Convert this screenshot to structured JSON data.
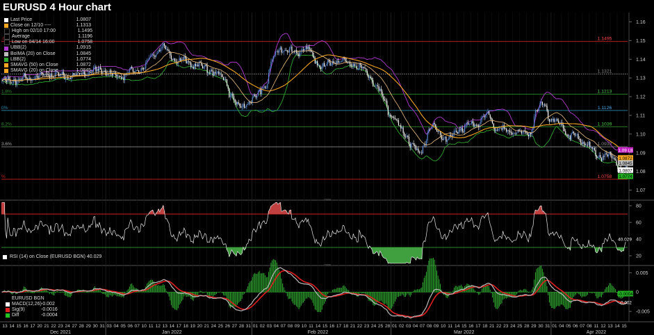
{
  "window": {
    "title": "EURUSD 4 Hour chart"
  },
  "legend": [
    {
      "label": "Last Price",
      "value": "1.0807",
      "color": "#ffffff"
    },
    {
      "label": "Close on 12/10 ----",
      "value": "1.1313",
      "color": "#f5a623"
    },
    {
      "label": "High on 02/10 17:00",
      "value": "1.1495",
      "color": "#000000"
    },
    {
      "label": "Average",
      "value": "1.1196",
      "color": "#000000"
    },
    {
      "label": "Low on 04/14 16:00",
      "value": "1.0758",
      "color": "#000000"
    },
    {
      "label": "UBB(2)",
      "value": "1.0915",
      "color": "#b03ad0"
    },
    {
      "label": "BoIMA (20)  on Close",
      "value": "1.0845",
      "color": "#bbbbbb"
    },
    {
      "label": "LBB(2)",
      "value": "1.0774",
      "color": "#2fa82f"
    },
    {
      "label": "SMAVG (50)  on Close",
      "value": "1.0872",
      "color": "#f5a623"
    },
    {
      "label": "SMAVG (20)  on Close",
      "value": "1.0845",
      "color": "#f5a623"
    }
  ],
  "rsi": {
    "label": "RSI (14)  on Close (EURUSD BGN) 40.029",
    "value_badge": "40.029"
  },
  "macd": {
    "title": "EURUSD BGN",
    "rows": [
      {
        "label": "MACD(12,26)",
        "value": "-0.002",
        "color": "#ffffff"
      },
      {
        "label": "Sig(9)",
        "value": "-0.0016",
        "color": "#e02020"
      },
      {
        "label": "Diff",
        "value": "-0.0004",
        "color": "#22c022"
      }
    ]
  },
  "colors": {
    "up": "#5b8bd8",
    "down": "#ffffff",
    "upper_band": "#b03ad0",
    "lower_band": "#2fa82f",
    "sma": "#f5a623",
    "fib_red": "#cc2222",
    "fib_green": "#2a8a2a",
    "fib_blue": "#2a8ab0",
    "grid": "#151515"
  },
  "chart_data": [
    {
      "type": "candlestick",
      "title": "EURUSD 4 Hour chart",
      "ylim": [
        1.065,
        1.165
      ],
      "y_ticks": [
        "1.16",
        "1.15",
        "1.14",
        "1.13",
        "1.12",
        "1.11",
        "1.10",
        "1.09",
        "1.08",
        "1.07"
      ],
      "x_days": [
        "13",
        "14",
        "15",
        "16",
        "17",
        "20",
        "21",
        "22",
        "23",
        "24",
        "27",
        "28",
        "29",
        "30",
        "31",
        "03",
        "04",
        "05",
        "06",
        "07",
        "10",
        "11",
        "12",
        "13",
        "14",
        "17",
        "18",
        "19",
        "20",
        "21",
        "24",
        "25",
        "26",
        "27",
        "28",
        "31",
        "01",
        "02",
        "03",
        "04",
        "07",
        "08",
        "09",
        "10",
        "11",
        "14",
        "15",
        "16",
        "17",
        "18",
        "21",
        "22",
        "23",
        "24",
        "25",
        "28",
        "01",
        "02",
        "03",
        "04",
        "07",
        "08",
        "09",
        "10",
        "11",
        "14",
        "15",
        "16",
        "17",
        "18",
        "21",
        "22",
        "23",
        "24",
        "25",
        "28",
        "29",
        "30",
        "31",
        "01",
        "04",
        "05",
        "06",
        "07",
        "08",
        "11",
        "12",
        "13",
        "14",
        "15"
      ],
      "months": [
        {
          "label": "Dec 2021",
          "day_index": 8
        },
        {
          "label": "Jan 2022",
          "day_index": 24
        },
        {
          "label": "Feb 2022",
          "day_index": 45
        },
        {
          "label": "Mar 2022",
          "day_index": 66
        },
        {
          "label": "Apr 2022",
          "day_index": 85
        }
      ],
      "close_anchors": [
        [
          0,
          1.128
        ],
        [
          4,
          1.13
        ],
        [
          7,
          1.132
        ],
        [
          10,
          1.131
        ],
        [
          14,
          1.134
        ],
        [
          17,
          1.131
        ],
        [
          20,
          1.135
        ],
        [
          22,
          1.143
        ],
        [
          23,
          1.147
        ],
        [
          25,
          1.14
        ],
        [
          28,
          1.137
        ],
        [
          30,
          1.134
        ],
        [
          32,
          1.13
        ],
        [
          33,
          1.121
        ],
        [
          34,
          1.114
        ],
        [
          36,
          1.118
        ],
        [
          38,
          1.126
        ],
        [
          39,
          1.14
        ],
        [
          40,
          1.146
        ],
        [
          42,
          1.144
        ],
        [
          44,
          1.145
        ],
        [
          46,
          1.136
        ],
        [
          48,
          1.139
        ],
        [
          50,
          1.138
        ],
        [
          52,
          1.135
        ],
        [
          53,
          1.13
        ],
        [
          54,
          1.125
        ],
        [
          55,
          1.118
        ],
        [
          56,
          1.11
        ],
        [
          58,
          1.101
        ],
        [
          59,
          1.094
        ],
        [
          60,
          1.09
        ],
        [
          62,
          1.104
        ],
        [
          64,
          1.097
        ],
        [
          66,
          1.103
        ],
        [
          68,
          1.105
        ],
        [
          70,
          1.11
        ],
        [
          71,
          1.103
        ],
        [
          74,
          1.101
        ],
        [
          76,
          1.1
        ],
        [
          77,
          1.112
        ],
        [
          78,
          1.116
        ],
        [
          79,
          1.108
        ],
        [
          80,
          1.106
        ],
        [
          82,
          1.099
        ],
        [
          84,
          1.095
        ],
        [
          86,
          1.088
        ],
        [
          87,
          1.089
        ],
        [
          88,
          1.087
        ],
        [
          89,
          1.082
        ],
        [
          90,
          1.081
        ]
      ],
      "price_labels": [
        {
          "text": "1.1495",
          "value": 1.1495,
          "color": "#ff4444"
        },
        {
          "text": "1.1321",
          "value": 1.1321,
          "color": "#888888"
        },
        {
          "text": "1.1213",
          "value": 1.1213,
          "color": "#44cc44"
        },
        {
          "text": "1.1126",
          "value": 1.1126,
          "color": "#44aaee"
        },
        {
          "text": "1.1039",
          "value": 1.1039,
          "color": "#44cc44"
        },
        {
          "text": "1.0932",
          "value": 1.0932,
          "color": "#888888"
        },
        {
          "text": "1.0758",
          "value": 1.0758,
          "color": "#ff4444"
        }
      ],
      "badges": [
        {
          "text": "1.09 L8",
          "value": 1.0915,
          "bg": "#c020c0",
          "fg": "#ffffff"
        },
        {
          "text": "1.0872",
          "value": 1.0872,
          "bg": "#f5a623",
          "fg": "#000000"
        },
        {
          "text": "1.0845",
          "value": 1.0845,
          "bg": "#bbbbbb",
          "fg": "#000000"
        },
        {
          "text": "1.0807",
          "value": 1.0807,
          "bg": "#ffffff",
          "fg": "#000000"
        },
        {
          "text": "1.0774",
          "value": 1.0774,
          "bg": "#22b022",
          "fg": "#000000"
        }
      ],
      "fib_lines": [
        {
          "value": 1.1495,
          "color": "#cc2222",
          "left_label": ".0%"
        },
        {
          "value": 1.1321,
          "color": "#888888",
          "left_label": "",
          "dotted": true
        },
        {
          "value": 1.1213,
          "color": "#2a8a2a",
          "left_label": "1.8%"
        },
        {
          "value": 1.1126,
          "color": "#2a8ab0",
          "left_label": "0%"
        },
        {
          "value": 1.1039,
          "color": "#2a8a2a",
          "left_label": "8.2%"
        },
        {
          "value": 1.0932,
          "color": "#888888",
          "left_label": "3.6%"
        },
        {
          "value": 1.0758,
          "color": "#cc2222",
          "left_label": "%"
        }
      ]
    },
    {
      "type": "line",
      "name": "RSI (14)",
      "ylim": [
        10,
        85
      ],
      "y_ticks": [
        "80",
        "60",
        "40",
        "20"
      ],
      "ref_lines": [
        {
          "value": 70,
          "color": "#cc2222"
        },
        {
          "value": 30,
          "color": "#2a8a2a"
        }
      ],
      "last": 40.029
    },
    {
      "type": "macd",
      "ylim": [
        -0.0075,
        0.0065
      ],
      "y_ticks": [
        "0.005",
        "0",
        "-0.005"
      ],
      "last_macd": "-0.002",
      "badge": "-0.0004"
    }
  ]
}
